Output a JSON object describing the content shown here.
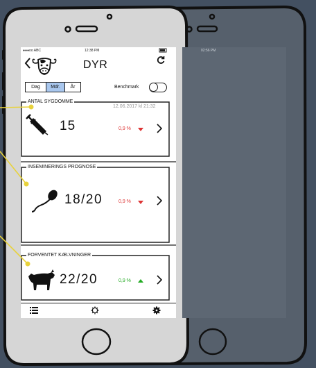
{
  "phone1": {
    "status": {
      "carrier": "●●●oo ABC",
      "time": "12:38 PM"
    },
    "header": {
      "title": "DYR",
      "back_icon": "chevron-left-icon",
      "app_icon": "cow-head-icon",
      "refresh_icon": "refresh-icon"
    },
    "period_tabs": [
      {
        "label": "Dag",
        "active": false
      },
      {
        "label": "Mdr.",
        "active": true
      },
      {
        "label": "År",
        "active": false
      }
    ],
    "benchmark": {
      "label": "Benchmark",
      "on": false
    },
    "cards": {
      "sygdomme": {
        "title": "ANTAL SYGDOMME",
        "date": "12.06.2017 kl 21:32",
        "value": "15",
        "change": "0,9 %",
        "trend": "down",
        "icon": "syringe-icon"
      },
      "prognose": {
        "title": "INSEMINERINGS PROGNOSE",
        "value": "18/20",
        "change": "0,9 %",
        "trend": "down",
        "icon": "sperm-icon"
      },
      "kaelvninger": {
        "title": "FORVENTET KÆLVNINGER",
        "value": "22/20",
        "change": "0,9 %",
        "trend": "up",
        "icon": "calf-icon"
      }
    },
    "tabbar": [
      {
        "icon": "list-icon"
      },
      {
        "icon": "gear-outline-icon"
      },
      {
        "icon": "gear-filled-icon"
      }
    ]
  },
  "phone2": {
    "status": {
      "time": "02:56 PM"
    }
  },
  "colors": {
    "background": "#435061",
    "phone_body": "#d6d6d6",
    "phone2_body": "#56606c",
    "active_tab": "#a9c7ee",
    "down": "#dd3333",
    "up": "#22aa22",
    "annotation": "#e8d23c"
  }
}
